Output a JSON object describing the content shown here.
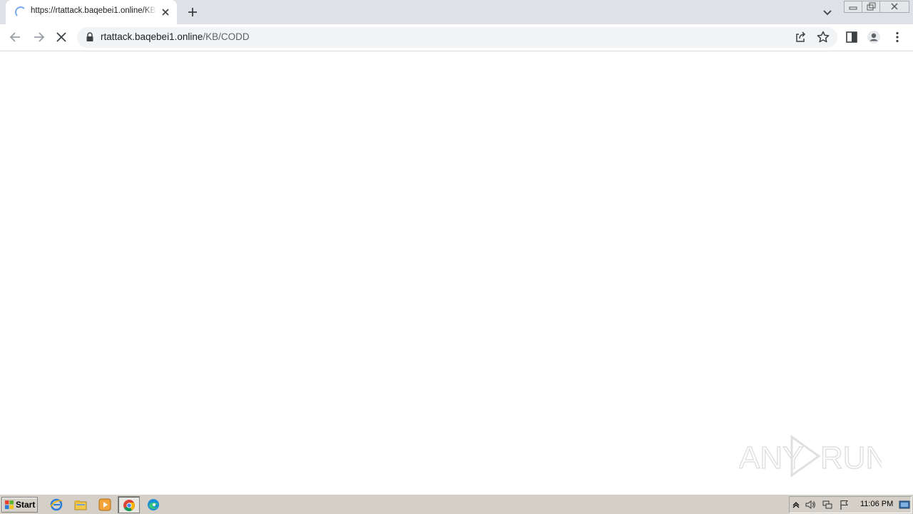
{
  "browser": {
    "tab": {
      "title": "https://rtattack.baqebei1.online/KB/",
      "state": "loading"
    },
    "omnibox": {
      "host": "rtattack.baqebei1.online",
      "path": "/KB/CODD"
    },
    "colors": {
      "tabstrip": "#dee1e6",
      "omnibox_bg": "#f1f3f4",
      "accent": "#1a73e8"
    }
  },
  "watermark": {
    "text": "ANY RUN"
  },
  "taskbar": {
    "start_label": "Start",
    "pinned": [
      "internet-explorer-icon",
      "file-explorer-icon",
      "media-player-icon",
      "chrome-icon",
      "edge-icon"
    ],
    "clock": "11:06 PM"
  }
}
